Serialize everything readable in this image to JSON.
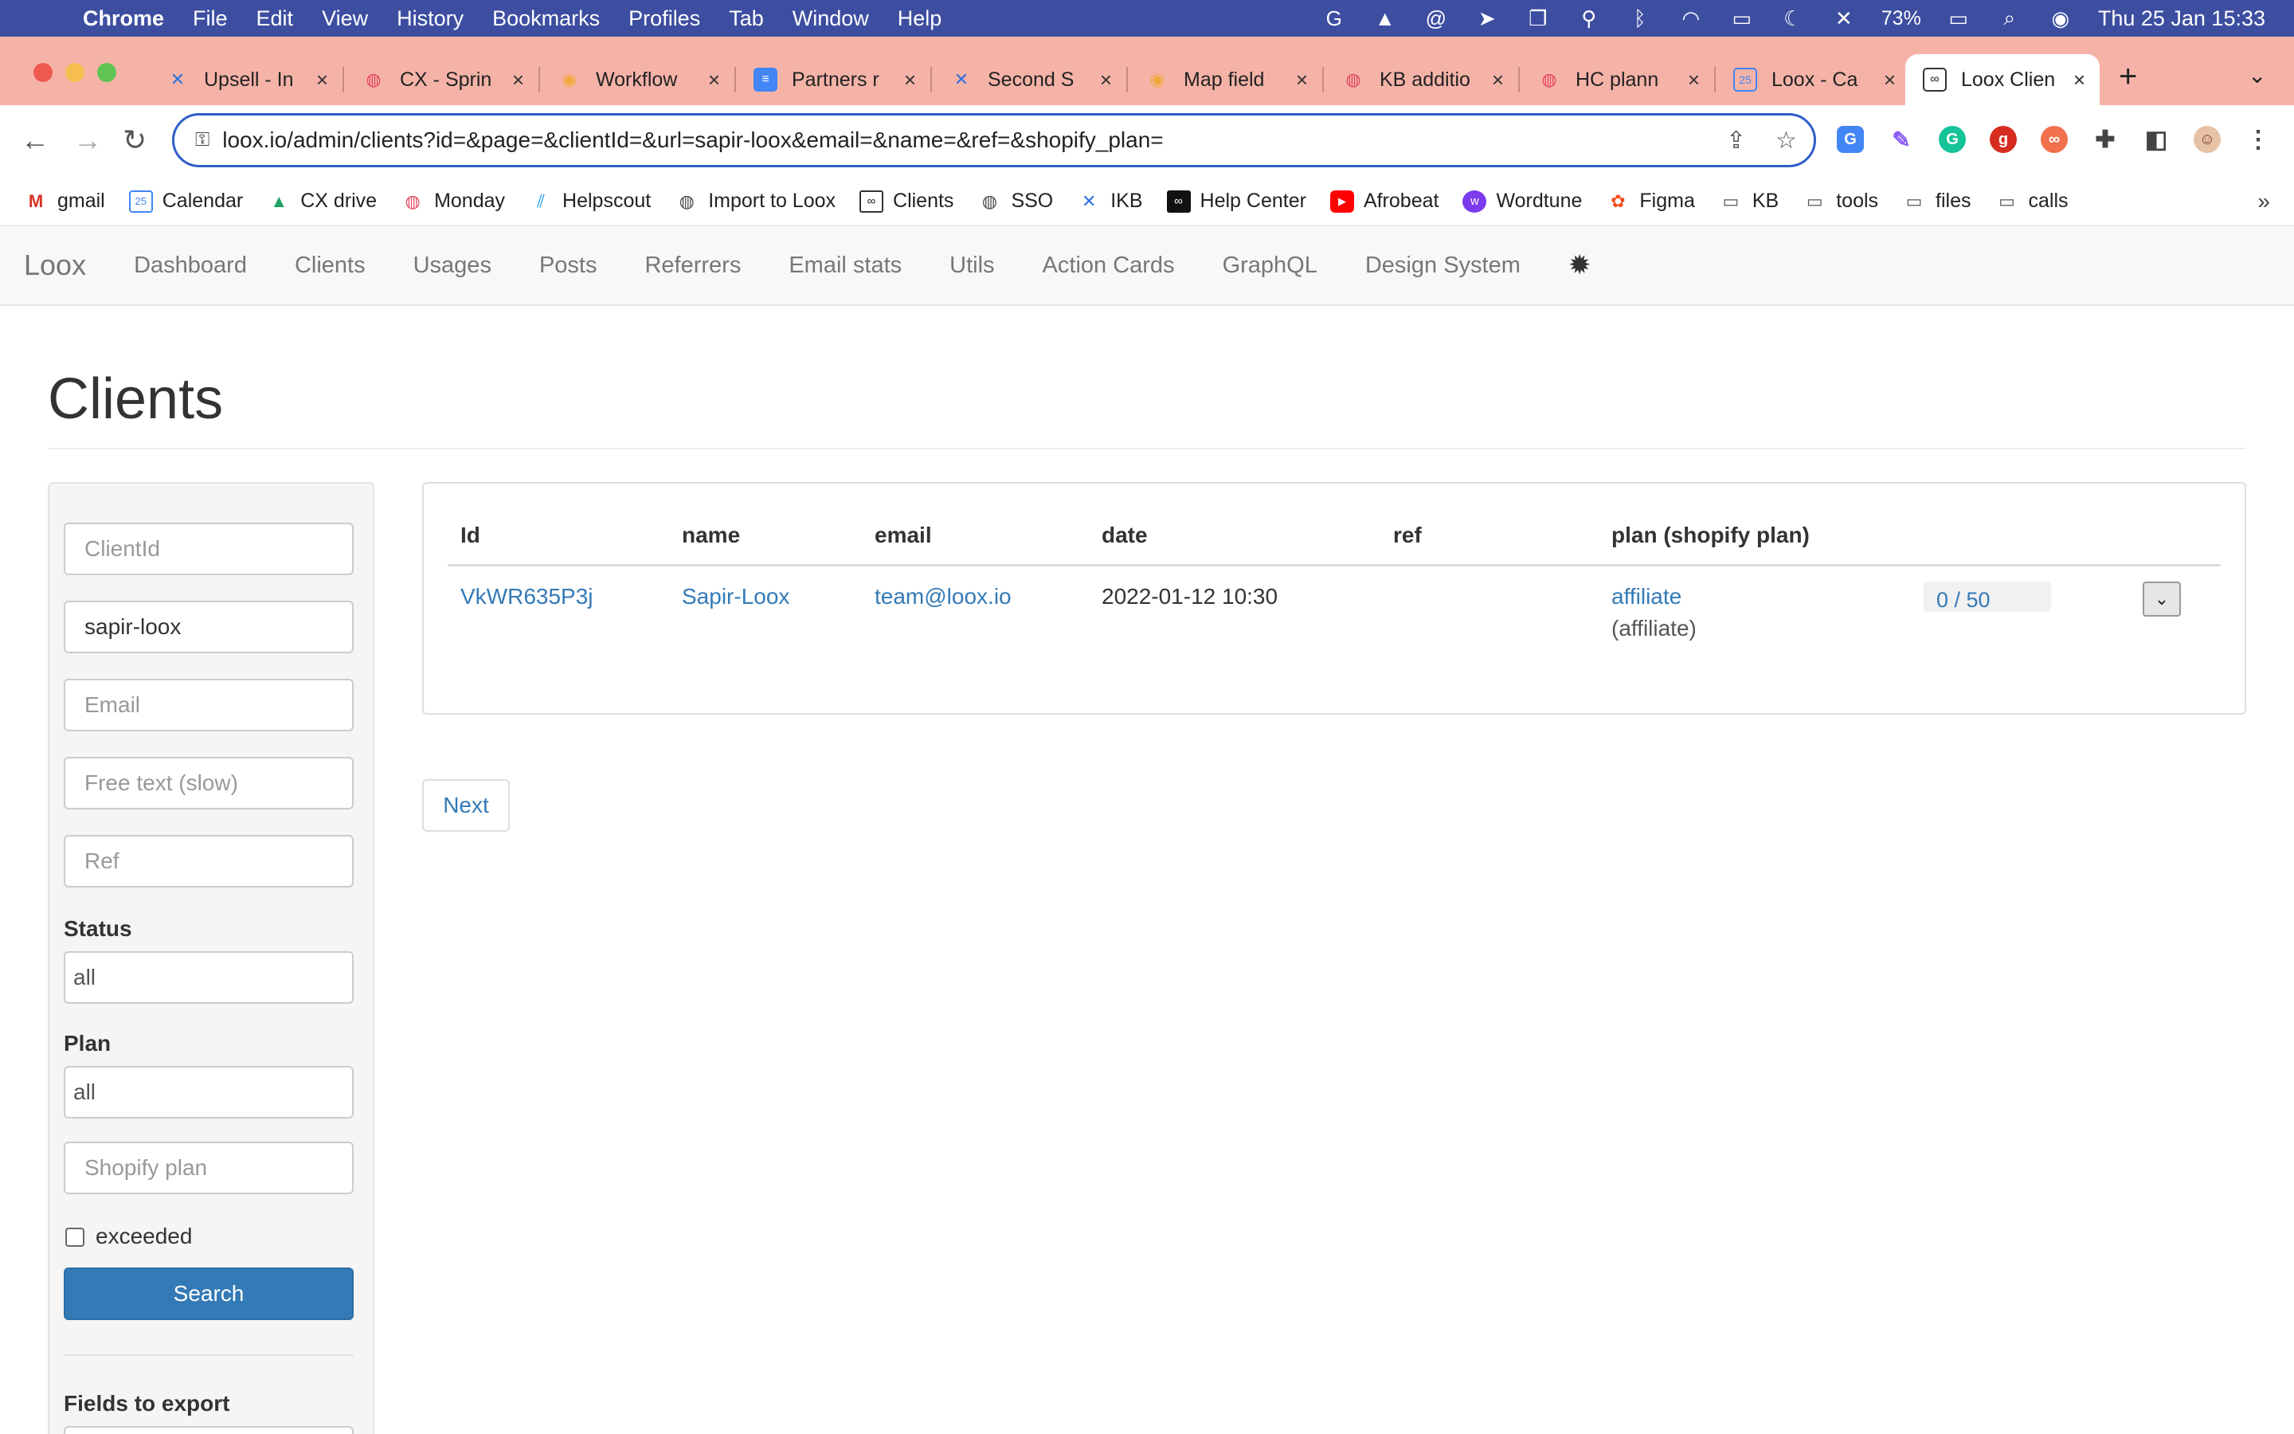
{
  "menubar": {
    "app": "Chrome",
    "items": [
      "File",
      "Edit",
      "View",
      "History",
      "Bookmarks",
      "Profiles",
      "Tab",
      "Window",
      "Help"
    ],
    "battery": "73%",
    "datetime": "Thu 25 Jan  15:33"
  },
  "tabs": [
    {
      "label": "Upsell - In",
      "icon": "confluence-icon",
      "color": "#2f6fdf"
    },
    {
      "label": "CX - Sprin",
      "icon": "monday-icon",
      "color": "#e2445c"
    },
    {
      "label": "Workflow",
      "icon": "workflow-icon",
      "color": "#f2a93b"
    },
    {
      "label": "Partners r",
      "icon": "docs-icon",
      "color": "#4285f4"
    },
    {
      "label": "Second S",
      "icon": "confluence-icon",
      "color": "#2f6fdf"
    },
    {
      "label": "Map field",
      "icon": "workflow-icon",
      "color": "#f2a93b"
    },
    {
      "label": "KB additio",
      "icon": "monday-icon",
      "color": "#e2445c"
    },
    {
      "label": "HC plann",
      "icon": "monday-icon",
      "color": "#e2445c"
    },
    {
      "label": "Loox - Ca",
      "icon": "calendar-icon",
      "color": "#4285f4"
    },
    {
      "label": "Loox Clien",
      "icon": "loox-icon",
      "color": "#222222"
    }
  ],
  "address": {
    "url": "loox.io/admin/clients?id=&page=&clientId=&url=sapir-loox&email=&name=&ref=&shopify_plan="
  },
  "bookmarks": [
    {
      "label": "gmail",
      "icon": "gmail-icon"
    },
    {
      "label": "Calendar",
      "icon": "calendar-icon"
    },
    {
      "label": "CX drive",
      "icon": "drive-icon"
    },
    {
      "label": "Monday",
      "icon": "monday-icon"
    },
    {
      "label": "Helpscout",
      "icon": "helpscout-icon"
    },
    {
      "label": "Import to Loox",
      "icon": "globe-icon"
    },
    {
      "label": "Clients",
      "icon": "loox-icon"
    },
    {
      "label": "SSO",
      "icon": "globe-icon"
    },
    {
      "label": "IKB",
      "icon": "confluence-icon"
    },
    {
      "label": "Help Center",
      "icon": "loox-icon"
    },
    {
      "label": "Afrobeat",
      "icon": "youtube-icon"
    },
    {
      "label": "Wordtune",
      "icon": "wordtune-icon"
    },
    {
      "label": "Figma",
      "icon": "figma-icon"
    },
    {
      "label": "KB",
      "icon": "folder-icon"
    },
    {
      "label": "tools",
      "icon": "folder-icon"
    },
    {
      "label": "files",
      "icon": "folder-icon"
    },
    {
      "label": "calls",
      "icon": "folder-icon"
    }
  ],
  "appnav": {
    "brand": "Loox",
    "items": [
      "Dashboard",
      "Clients",
      "Usages",
      "Posts",
      "Referrers",
      "Email stats",
      "Utils",
      "Action Cards",
      "GraphQL",
      "Design System"
    ]
  },
  "page": {
    "title": "Clients"
  },
  "filters": {
    "client_id_placeholder": "ClientId",
    "url_value": "sapir-loox",
    "email_placeholder": "Email",
    "free_text_placeholder": "Free text (slow)",
    "ref_placeholder": "Ref",
    "status_label": "Status",
    "status_value": "all",
    "plan_label": "Plan",
    "plan_value": "all",
    "shopify_plan_placeholder": "Shopify plan",
    "exceeded_label": "exceeded",
    "search_label": "Search",
    "export_label": "Fields to export"
  },
  "table": {
    "headers": [
      "Id",
      "name",
      "email",
      "date",
      "ref",
      "plan (shopify plan)"
    ],
    "rows": [
      {
        "id": "VkWR635P3j",
        "name": "Sapir-Loox",
        "email": "team@loox.io",
        "date": "2022-01-12 10:30",
        "ref": "",
        "plan": "affiliate",
        "shopify_plan": "(affiliate)",
        "usage": "0 / 50"
      }
    ]
  },
  "pager": {
    "next_label": "Next"
  },
  "colors": {
    "link": "#337ab7",
    "primary_button": "#337ab7",
    "menubar": "#3d4ea1",
    "tabstrip": "#f5b3a8"
  }
}
